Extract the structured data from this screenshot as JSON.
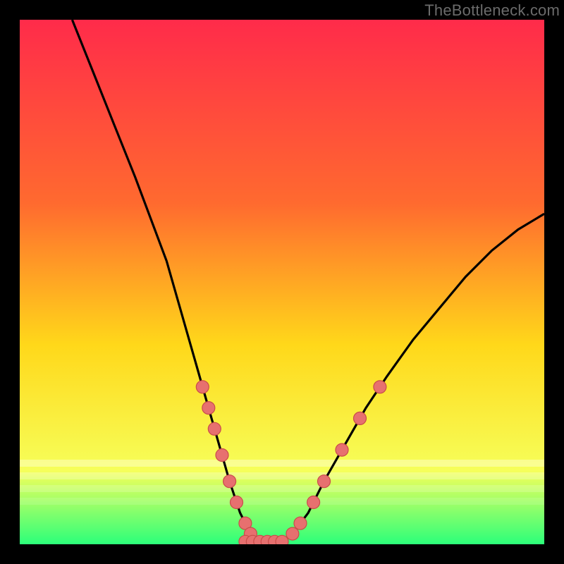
{
  "watermark": "TheBottleneck.com",
  "colors": {
    "gradient_top": "#ff2b4a",
    "gradient_mid1": "#ff6a2f",
    "gradient_mid2": "#ffd81a",
    "gradient_mid3": "#f6ff5a",
    "gradient_bottom": "#2cff7a",
    "curve": "#000000",
    "bead_fill": "#e7706f",
    "bead_stroke": "#c94c4a"
  },
  "chart_data": {
    "type": "line",
    "title": "",
    "xlabel": "",
    "ylabel": "",
    "xlim": [
      0,
      100
    ],
    "ylim": [
      0,
      100
    ],
    "series": [
      {
        "name": "bottleneck-curve",
        "x": [
          10,
          14,
          18,
          22,
          25,
          28,
          30,
          32,
          34,
          36,
          38,
          40,
          42,
          44,
          46,
          48,
          50,
          52,
          55,
          58,
          62,
          66,
          70,
          75,
          80,
          85,
          90,
          95,
          100
        ],
        "y": [
          100,
          90,
          80,
          70,
          62,
          54,
          47,
          40,
          33,
          26,
          19,
          12,
          6,
          2,
          0.5,
          0.5,
          0.5,
          2,
          6,
          12,
          19,
          26,
          32,
          39,
          45,
          51,
          56,
          60,
          63
        ]
      }
    ],
    "beads_left": [
      30,
      26,
      22,
      17,
      12,
      8,
      4,
      2
    ],
    "beads_right": [
      2,
      4,
      8,
      12,
      18,
      24,
      30
    ],
    "flat_y": 0.5,
    "flat_x_range": [
      43,
      50
    ]
  }
}
